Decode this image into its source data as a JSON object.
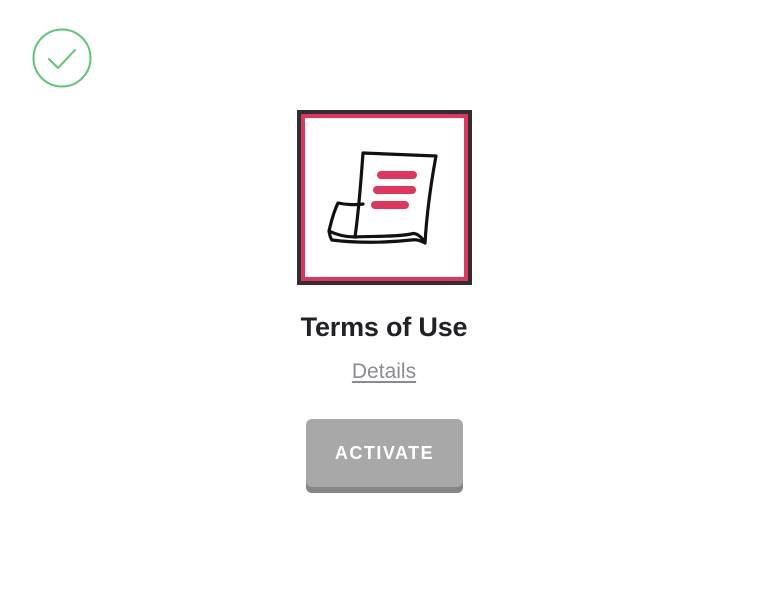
{
  "status": {
    "icon": "check-circle-icon",
    "color": "#5cc479"
  },
  "card": {
    "icon": "scroll-document-icon",
    "accent_color": "#e0365e",
    "frame_color": "#2e2e33",
    "title": "Terms of Use",
    "details_label": "Details",
    "activate_label": "ACTIVATE",
    "button_color": "#a8a8a8"
  }
}
